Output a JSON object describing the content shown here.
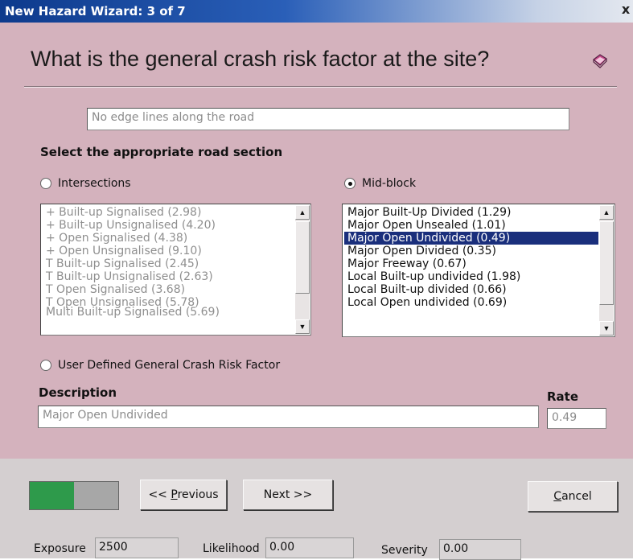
{
  "window": {
    "title": "New Hazard Wizard: 3 of 7",
    "close_glyph": "x"
  },
  "question": "What is the general crash risk factor at the site?",
  "hazard_field": {
    "value": "No edge lines along the road"
  },
  "section_label": "Select the appropriate road section",
  "intersections": {
    "label": "Intersections",
    "selected": false,
    "items": [
      "+ Built-up Signalised (2.98)",
      "+ Built-up Unsignalised (4.20)",
      "+ Open Signalised (4.38)",
      "+ Open Unsignalised (9.10)",
      "T Built-up Signalised (2.45)",
      "T Built-up Unsignalised (2.63)",
      "T Open Signalised (3.68)",
      "T Open Unsignalised (5.78)",
      "Multi Built-up Signalised (5.69)"
    ]
  },
  "midblock": {
    "label": "Mid-block",
    "selected": true,
    "items": [
      "Major Built-Up Divided (1.29)",
      "Major Open Unsealed (1.01)",
      "Major Open Undivided (0.49)",
      "Major Open Divided (0.35)",
      "Major Freeway (0.67)",
      "Local Built-up undivided (1.98)",
      "Local Built-up divided (0.66)",
      "Local Open undivided (0.69)"
    ],
    "selected_index": 2
  },
  "user_defined": {
    "label": "User Defined General Crash Risk Factor",
    "selected": false
  },
  "description": {
    "header": "Description",
    "value": "Major Open Undivided"
  },
  "rate": {
    "header": "Rate",
    "value": "0.49"
  },
  "progress": {
    "fraction": 0.5
  },
  "buttons": {
    "previous_prefix": "<< ",
    "previous_mnemonic": "P",
    "previous_rest": "revious",
    "next": "Next >>",
    "cancel_mnemonic": "C",
    "cancel_rest": "ancel"
  },
  "stats": {
    "exposure_label": "Exposure",
    "exposure_value": "2500",
    "likelihood_label": "Likelihood",
    "likelihood_value": "0.00",
    "severity_label": "Severity",
    "severity_value": "0.00"
  },
  "icons": {
    "help": "help-book-icon",
    "scroll_up": "scroll-up-arrow-icon",
    "scroll_down": "scroll-down-arrow-icon"
  },
  "colors": {
    "accent_green": "#2e9a4b",
    "selection": "#1a2f7c",
    "dialog_bg": "#d4b2bd"
  }
}
